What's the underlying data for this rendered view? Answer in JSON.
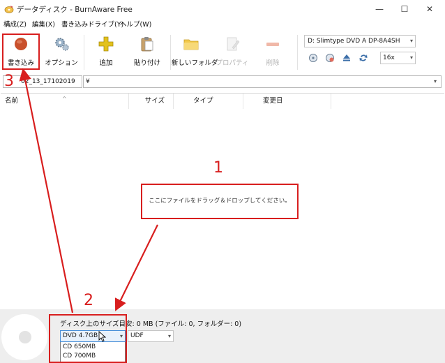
{
  "window": {
    "title": "データディスク - BurnAware Free",
    "minimize": "—",
    "maximize": "☐",
    "close": "✕"
  },
  "menu": [
    "構成(Z)",
    "編集(X)",
    "書き込みドライブ(Y)",
    "ヘルプ(W)"
  ],
  "toolbar": {
    "burn": "書き込み",
    "options": "オプション",
    "add": "追加",
    "paste": "貼り付け",
    "new_folder": "新しいフォルダ",
    "properties": "プロパティ",
    "delete": "削除",
    "drive": "D: Slimtype DVD A  DP-8A4SH",
    "speed": "16x"
  },
  "address": {
    "disc_label": "02_13_17102019",
    "path": "¥"
  },
  "columns": [
    "名前",
    "サイズ",
    "タイプ",
    "変更日"
  ],
  "drop_hint": "ここにファイルをドラッグ＆ドロップしてください。",
  "status": {
    "size_text": "ディスク上のサイズ目安: 0 MB (ファイル: 0, フォルダー: 0)",
    "disc_size": "DVD 4.7GB",
    "filesystem": "UDF",
    "options": [
      "CD 650MB",
      "CD 700MB"
    ]
  },
  "annotations": {
    "step1": "1",
    "step2": "2",
    "step3": "3"
  },
  "colors": {
    "annotation": "#d81e1e",
    "burn_icon": "#c9502c",
    "add_icon": "#e3c21c",
    "folder_icon": "#f2c94c",
    "status_bg": "#eeeeee"
  },
  "icons": {
    "app": "burn-disc-icon",
    "burn": "record-circle-icon",
    "options": "gears-icon",
    "add": "plus-icon",
    "paste": "clipboard-icon",
    "new_folder": "folder-icon",
    "properties": "document-pencil-icon",
    "delete": "minus-icon"
  }
}
